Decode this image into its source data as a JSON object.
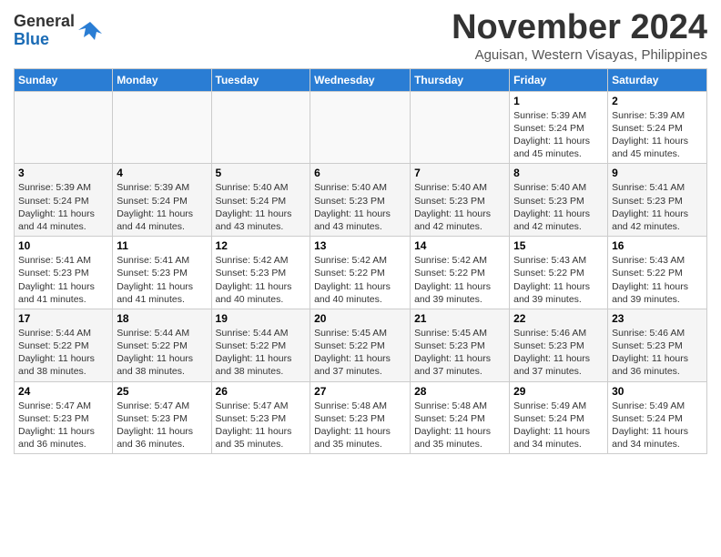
{
  "logo": {
    "general": "General",
    "blue": "Blue"
  },
  "header": {
    "month": "November 2024",
    "location": "Aguisan, Western Visayas, Philippines"
  },
  "weekdays": [
    "Sunday",
    "Monday",
    "Tuesday",
    "Wednesday",
    "Thursday",
    "Friday",
    "Saturday"
  ],
  "weeks": [
    [
      {
        "day": "",
        "info": ""
      },
      {
        "day": "",
        "info": ""
      },
      {
        "day": "",
        "info": ""
      },
      {
        "day": "",
        "info": ""
      },
      {
        "day": "",
        "info": ""
      },
      {
        "day": "1",
        "info": "Sunrise: 5:39 AM\nSunset: 5:24 PM\nDaylight: 11 hours\nand 45 minutes."
      },
      {
        "day": "2",
        "info": "Sunrise: 5:39 AM\nSunset: 5:24 PM\nDaylight: 11 hours\nand 45 minutes."
      }
    ],
    [
      {
        "day": "3",
        "info": "Sunrise: 5:39 AM\nSunset: 5:24 PM\nDaylight: 11 hours\nand 44 minutes."
      },
      {
        "day": "4",
        "info": "Sunrise: 5:39 AM\nSunset: 5:24 PM\nDaylight: 11 hours\nand 44 minutes."
      },
      {
        "day": "5",
        "info": "Sunrise: 5:40 AM\nSunset: 5:24 PM\nDaylight: 11 hours\nand 43 minutes."
      },
      {
        "day": "6",
        "info": "Sunrise: 5:40 AM\nSunset: 5:23 PM\nDaylight: 11 hours\nand 43 minutes."
      },
      {
        "day": "7",
        "info": "Sunrise: 5:40 AM\nSunset: 5:23 PM\nDaylight: 11 hours\nand 42 minutes."
      },
      {
        "day": "8",
        "info": "Sunrise: 5:40 AM\nSunset: 5:23 PM\nDaylight: 11 hours\nand 42 minutes."
      },
      {
        "day": "9",
        "info": "Sunrise: 5:41 AM\nSunset: 5:23 PM\nDaylight: 11 hours\nand 42 minutes."
      }
    ],
    [
      {
        "day": "10",
        "info": "Sunrise: 5:41 AM\nSunset: 5:23 PM\nDaylight: 11 hours\nand 41 minutes."
      },
      {
        "day": "11",
        "info": "Sunrise: 5:41 AM\nSunset: 5:23 PM\nDaylight: 11 hours\nand 41 minutes."
      },
      {
        "day": "12",
        "info": "Sunrise: 5:42 AM\nSunset: 5:23 PM\nDaylight: 11 hours\nand 40 minutes."
      },
      {
        "day": "13",
        "info": "Sunrise: 5:42 AM\nSunset: 5:22 PM\nDaylight: 11 hours\nand 40 minutes."
      },
      {
        "day": "14",
        "info": "Sunrise: 5:42 AM\nSunset: 5:22 PM\nDaylight: 11 hours\nand 39 minutes."
      },
      {
        "day": "15",
        "info": "Sunrise: 5:43 AM\nSunset: 5:22 PM\nDaylight: 11 hours\nand 39 minutes."
      },
      {
        "day": "16",
        "info": "Sunrise: 5:43 AM\nSunset: 5:22 PM\nDaylight: 11 hours\nand 39 minutes."
      }
    ],
    [
      {
        "day": "17",
        "info": "Sunrise: 5:44 AM\nSunset: 5:22 PM\nDaylight: 11 hours\nand 38 minutes."
      },
      {
        "day": "18",
        "info": "Sunrise: 5:44 AM\nSunset: 5:22 PM\nDaylight: 11 hours\nand 38 minutes."
      },
      {
        "day": "19",
        "info": "Sunrise: 5:44 AM\nSunset: 5:22 PM\nDaylight: 11 hours\nand 38 minutes."
      },
      {
        "day": "20",
        "info": "Sunrise: 5:45 AM\nSunset: 5:22 PM\nDaylight: 11 hours\nand 37 minutes."
      },
      {
        "day": "21",
        "info": "Sunrise: 5:45 AM\nSunset: 5:23 PM\nDaylight: 11 hours\nand 37 minutes."
      },
      {
        "day": "22",
        "info": "Sunrise: 5:46 AM\nSunset: 5:23 PM\nDaylight: 11 hours\nand 37 minutes."
      },
      {
        "day": "23",
        "info": "Sunrise: 5:46 AM\nSunset: 5:23 PM\nDaylight: 11 hours\nand 36 minutes."
      }
    ],
    [
      {
        "day": "24",
        "info": "Sunrise: 5:47 AM\nSunset: 5:23 PM\nDaylight: 11 hours\nand 36 minutes."
      },
      {
        "day": "25",
        "info": "Sunrise: 5:47 AM\nSunset: 5:23 PM\nDaylight: 11 hours\nand 36 minutes."
      },
      {
        "day": "26",
        "info": "Sunrise: 5:47 AM\nSunset: 5:23 PM\nDaylight: 11 hours\nand 35 minutes."
      },
      {
        "day": "27",
        "info": "Sunrise: 5:48 AM\nSunset: 5:23 PM\nDaylight: 11 hours\nand 35 minutes."
      },
      {
        "day": "28",
        "info": "Sunrise: 5:48 AM\nSunset: 5:24 PM\nDaylight: 11 hours\nand 35 minutes."
      },
      {
        "day": "29",
        "info": "Sunrise: 5:49 AM\nSunset: 5:24 PM\nDaylight: 11 hours\nand 34 minutes."
      },
      {
        "day": "30",
        "info": "Sunrise: 5:49 AM\nSunset: 5:24 PM\nDaylight: 11 hours\nand 34 minutes."
      }
    ]
  ]
}
